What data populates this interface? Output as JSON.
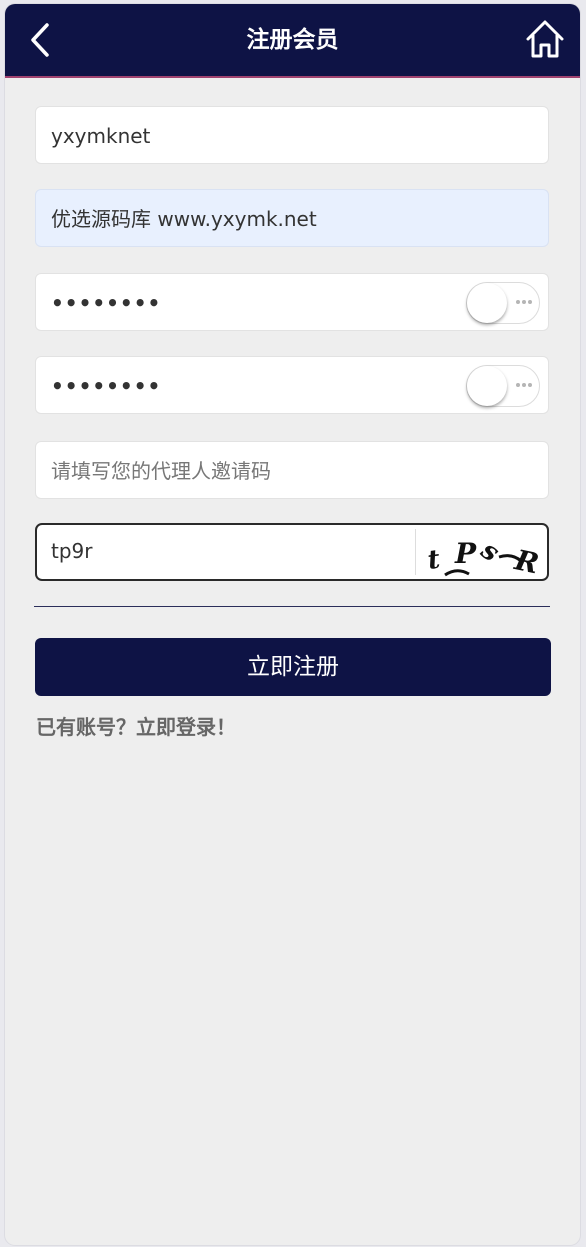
{
  "header": {
    "title": "注册会员",
    "back_icon": "chevron-left-icon",
    "home_icon": "home-icon",
    "background": "#0e1345",
    "accent_line": "#a0426f"
  },
  "form": {
    "username": {
      "value": "yxymknet"
    },
    "nickname": {
      "value": "优选源码库  www.yxymk.net"
    },
    "password": {
      "value": "••••••••",
      "toggle_on": false
    },
    "confirm_password": {
      "value": "••••••••",
      "toggle_on": false
    },
    "invite_code": {
      "placeholder": "请填写您的代理人邀请码"
    },
    "captcha": {
      "value": "tp9r",
      "image_text": "tPsR"
    }
  },
  "submit_label": "立即注册",
  "login_link": "已有账号？立即登录！"
}
